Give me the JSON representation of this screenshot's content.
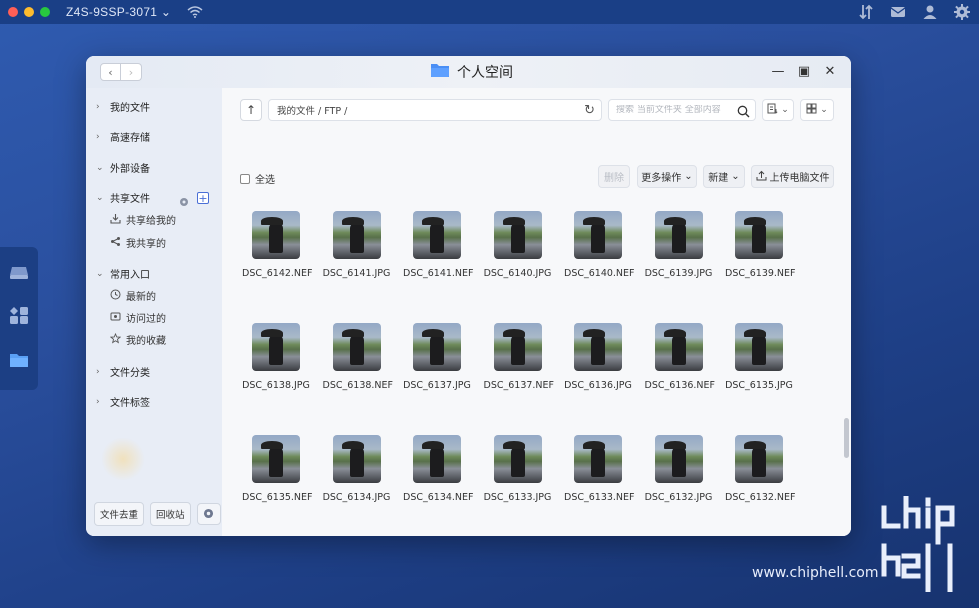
{
  "topbar": {
    "device_name": "Z4S-9SSP-3071"
  },
  "window": {
    "title": "个人空间"
  },
  "sidebar": {
    "items": [
      {
        "label": "我的文件"
      },
      {
        "label": "高速存储"
      },
      {
        "label": "外部设备"
      },
      {
        "label": "共享文件"
      },
      {
        "label": "常用入口"
      },
      {
        "label": "文件分类"
      },
      {
        "label": "文件标签"
      }
    ],
    "shared_sub": [
      {
        "label": "共享给我的"
      },
      {
        "label": "我共享的"
      }
    ],
    "common_sub": [
      {
        "label": "最新的"
      },
      {
        "label": "访问过的"
      },
      {
        "label": "我的收藏"
      }
    ],
    "bottom": {
      "dedupe": "文件去重",
      "recycle": "回收站"
    }
  },
  "toolbar": {
    "path": "我的文件 / FTP /",
    "search_placeholder": "搜索 当前文件夹 全部内容",
    "select_all": "全选",
    "delete": "删除",
    "more": "更多操作",
    "new": "新建",
    "upload": "上传电脑文件"
  },
  "files": [
    "DSC_6142.NEF",
    "DSC_6141.JPG",
    "DSC_6141.NEF",
    "DSC_6140.JPG",
    "DSC_6140.NEF",
    "DSC_6139.JPG",
    "DSC_6139.NEF",
    "DSC_6138.JPG",
    "DSC_6138.NEF",
    "DSC_6137.JPG",
    "DSC_6137.NEF",
    "DSC_6136.JPG",
    "DSC_6136.NEF",
    "DSC_6135.JPG",
    "DSC_6135.NEF",
    "DSC_6134.JPG",
    "DSC_6134.NEF",
    "DSC_6133.JPG",
    "DSC_6133.NEF",
    "DSC_6132.JPG",
    "DSC_6132.NEF"
  ],
  "watermark": {
    "url": "www.chiphell.com"
  },
  "colors": {
    "desktop": "#2a4f9e",
    "accent": "#4a6fd6"
  }
}
